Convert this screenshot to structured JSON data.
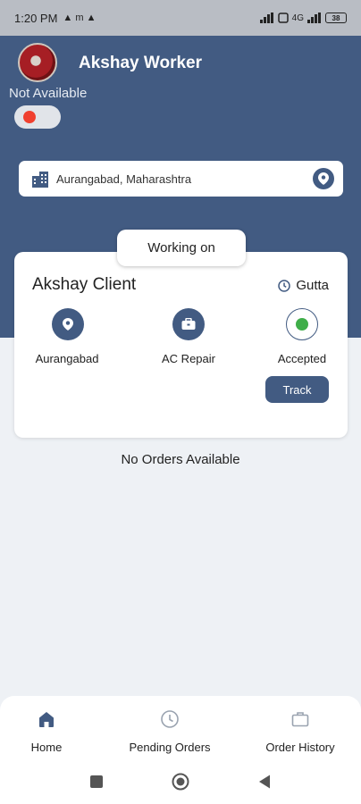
{
  "status_bar": {
    "time": "1:20 PM",
    "notification_glyphs": "▲ m ▲",
    "network": "4G",
    "battery": "38"
  },
  "profile": {
    "name": "Akshay Worker",
    "availability": "Not Available",
    "available": false
  },
  "location": {
    "text": "Aurangabad, Maharashtra"
  },
  "current_order": {
    "section_title": "Working on",
    "client_name": "Akshay Client",
    "area": "Gutta",
    "city": "Aurangabad",
    "service": "AC Repair",
    "status": "Accepted",
    "track_label": "Track"
  },
  "empty_state": "No Orders Available",
  "bottom_nav": {
    "items": [
      {
        "label": "Home",
        "icon": "home-icon",
        "active": true
      },
      {
        "label": "Pending Orders",
        "icon": "clock-icon",
        "active": false
      },
      {
        "label": "Order History",
        "icon": "briefcase-icon",
        "active": false
      }
    ]
  },
  "colors": {
    "primary": "#425b82",
    "status_red": "#f0402f",
    "accepted_green": "#3fae49",
    "background": "#eef1f5"
  }
}
